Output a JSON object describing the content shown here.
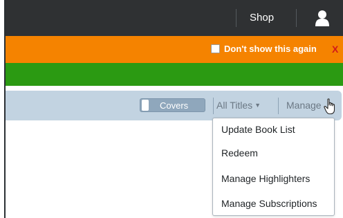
{
  "topbar": {
    "shop_label": "Shop",
    "user_icon": "user-icon"
  },
  "banner": {
    "dont_show_label": "Don't show this again",
    "dont_show_checked": false,
    "close_label": "X"
  },
  "toolbar": {
    "covers_label": "Covers",
    "all_titles_label": "All Titles",
    "manage_label": "Manage"
  },
  "menu": {
    "items": [
      {
        "label": "Update Book List"
      },
      {
        "label": "Redeem"
      },
      {
        "label": "Manage Highlighters"
      },
      {
        "label": "Manage Subscriptions"
      }
    ]
  },
  "colors": {
    "topbar": "#2f3133",
    "orange_banner": "#f58300",
    "green_banner": "#2b9a12",
    "toolbar": "#c2d3e1",
    "close_x": "#d21a1a"
  }
}
